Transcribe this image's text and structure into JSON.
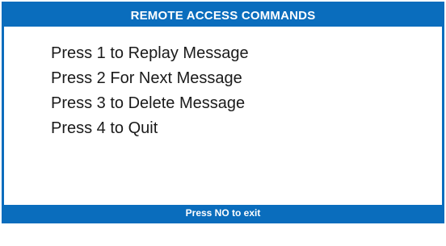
{
  "screen": {
    "title": "REMOTE ACCESS COMMANDS",
    "commands": [
      "Press 1 to Replay Message",
      "Press 2 For Next Message",
      "Press 3 to Delete Message",
      "Press 4 to Quit"
    ],
    "footer": "Press NO to exit"
  },
  "colors": {
    "accent": "#0a6dbd",
    "text": "#1a1a1a",
    "background": "#ffffff"
  }
}
